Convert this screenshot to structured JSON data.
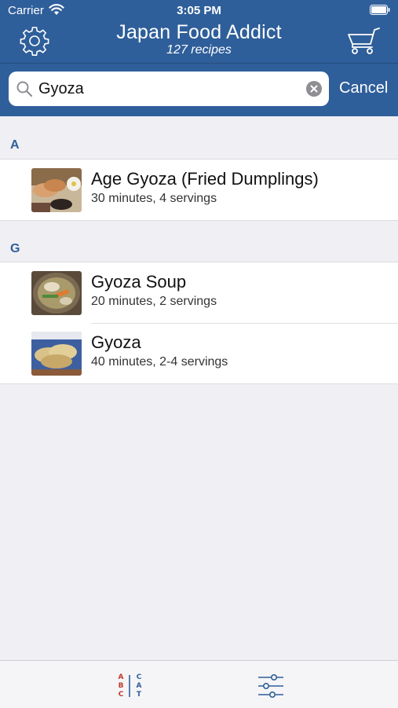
{
  "status": {
    "carrier": "Carrier",
    "time": "3:05 PM"
  },
  "header": {
    "title": "Japan Food Addict",
    "subtitle": "127 recipes"
  },
  "search": {
    "value": "Gyoza",
    "cancel_label": "Cancel"
  },
  "sections": [
    {
      "letter": "A",
      "items": [
        {
          "title": "Age Gyoza (Fried Dumplings)",
          "meta": "30 minutes, 4 servings"
        }
      ]
    },
    {
      "letter": "G",
      "items": [
        {
          "title": "Gyoza Soup",
          "meta": "20 minutes, 2 servings"
        },
        {
          "title": "Gyoza",
          "meta": "40 minutes, 2-4 servings"
        }
      ]
    }
  ],
  "tabbar": {
    "abc_letters": [
      "A",
      "B",
      "C"
    ],
    "cat_letters": [
      "C",
      "A",
      "T"
    ]
  },
  "colors": {
    "header_bg": "#2f5f9a",
    "accent": "#2f5f9a",
    "abc_red": "#c0392b"
  },
  "icons": [
    "wifi-icon",
    "battery-icon",
    "gear-icon",
    "cart-icon",
    "search-icon",
    "clear-icon",
    "abc-cat-icon",
    "filter-sliders-icon"
  ]
}
